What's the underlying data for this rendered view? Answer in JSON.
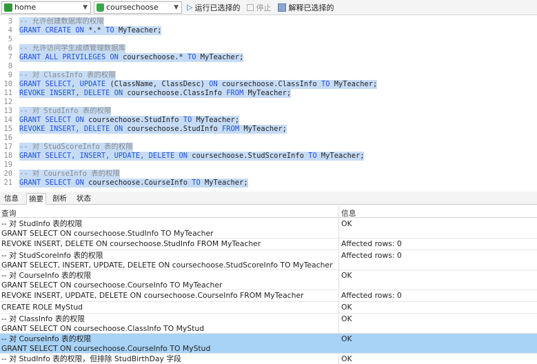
{
  "toolbar": {
    "connection": "home",
    "database": "coursechoose",
    "run_selected": "运行已选择的",
    "stop": "停止",
    "explain_selected": "解释已选择的"
  },
  "editor": {
    "lines": [
      {
        "n": "3",
        "segments": [
          {
            "t": "-- 允许创建数据库的权限",
            "c": "cm"
          }
        ]
      },
      {
        "n": "4",
        "segments": [
          {
            "t": "GRANT CREATE ON ",
            "c": "kw"
          },
          {
            "t": "*.* ",
            "c": "tx"
          },
          {
            "t": "TO ",
            "c": "kw"
          },
          {
            "t": "MyTeacher;",
            "c": "tx"
          }
        ]
      },
      {
        "n": "5",
        "segments": []
      },
      {
        "n": "6",
        "segments": [
          {
            "t": "-- 允许访问学生成绩管理数据库",
            "c": "cm"
          }
        ]
      },
      {
        "n": "7",
        "segments": [
          {
            "t": "GRANT ALL PRIVILEGES ON ",
            "c": "kw"
          },
          {
            "t": "coursechoose.* ",
            "c": "tx"
          },
          {
            "t": "TO ",
            "c": "kw"
          },
          {
            "t": "MyTeacher;",
            "c": "tx"
          }
        ]
      },
      {
        "n": "8",
        "segments": []
      },
      {
        "n": "9",
        "segments": [
          {
            "t": "-- 对 ClassInfo 表的权限",
            "c": "cm"
          }
        ]
      },
      {
        "n": "10",
        "segments": [
          {
            "t": "GRANT SELECT, UPDATE ",
            "c": "kw"
          },
          {
            "t": "(ClassName, ClassDesc) ",
            "c": "tx"
          },
          {
            "t": "ON ",
            "c": "kw"
          },
          {
            "t": "coursechoose.ClassInfo ",
            "c": "tx"
          },
          {
            "t": "TO ",
            "c": "kw"
          },
          {
            "t": "MyTeacher;",
            "c": "tx"
          }
        ]
      },
      {
        "n": "11",
        "segments": [
          {
            "t": "REVOKE INSERT, DELETE ON ",
            "c": "kw"
          },
          {
            "t": "coursechoose.ClassInfo ",
            "c": "tx"
          },
          {
            "t": "FROM ",
            "c": "kw"
          },
          {
            "t": "MyTeacher;",
            "c": "tx"
          }
        ]
      },
      {
        "n": "12",
        "segments": []
      },
      {
        "n": "13",
        "segments": [
          {
            "t": "-- 对 StudInfo 表的权限",
            "c": "cm"
          }
        ]
      },
      {
        "n": "14",
        "segments": [
          {
            "t": "GRANT SELECT ON ",
            "c": "kw"
          },
          {
            "t": "coursechoose.StudInfo ",
            "c": "tx"
          },
          {
            "t": "TO ",
            "c": "kw"
          },
          {
            "t": "MyTeacher;",
            "c": "tx"
          }
        ]
      },
      {
        "n": "15",
        "segments": [
          {
            "t": "REVOKE INSERT, DELETE ON ",
            "c": "kw"
          },
          {
            "t": "coursechoose.StudInfo ",
            "c": "tx"
          },
          {
            "t": "FROM ",
            "c": "kw"
          },
          {
            "t": "MyTeacher;",
            "c": "tx"
          }
        ]
      },
      {
        "n": "16",
        "segments": []
      },
      {
        "n": "17",
        "segments": [
          {
            "t": "-- 对 StudScoreInfo 表的权限",
            "c": "cm"
          }
        ]
      },
      {
        "n": "18",
        "segments": [
          {
            "t": "GRANT SELECT, INSERT, UPDATE, DELETE ON ",
            "c": "kw"
          },
          {
            "t": "coursechoose.StudScoreInfo ",
            "c": "tx"
          },
          {
            "t": "TO ",
            "c": "kw"
          },
          {
            "t": "MyTeacher;",
            "c": "tx"
          }
        ]
      },
      {
        "n": "19",
        "segments": []
      },
      {
        "n": "20",
        "segments": [
          {
            "t": "-- 对 CourseInfo 表的权限",
            "c": "cm"
          }
        ]
      },
      {
        "n": "21",
        "segments": [
          {
            "t": "GRANT SELECT ON ",
            "c": "kw"
          },
          {
            "t": "coursechoose.CourseInfo ",
            "c": "tx"
          },
          {
            "t": "TO ",
            "c": "kw"
          },
          {
            "t": "MyTeacher;",
            "c": "tx"
          }
        ]
      }
    ]
  },
  "tabs": [
    {
      "label": "信息",
      "active": false
    },
    {
      "label": "摘要",
      "active": true
    },
    {
      "label": "剖析",
      "active": false
    },
    {
      "label": "状态",
      "active": false
    }
  ],
  "results": {
    "headers": {
      "query": "查询",
      "info": "信息"
    },
    "rows": [
      {
        "q": "-- 对 StudInfo 表的权限\nGRANT SELECT ON coursechoose.StudInfo TO MyTeacher",
        "i": "OK",
        "lines": 2,
        "selected": false
      },
      {
        "q": "REVOKE INSERT, DELETE ON coursechoose.StudInfo FROM MyTeacher",
        "i": "Affected rows: 0",
        "lines": 1,
        "selected": false
      },
      {
        "q": "-- 对 StudScoreInfo 表的权限\nGRANT SELECT, INSERT, UPDATE, DELETE ON coursechoose.StudScoreInfo TO MyTeacher",
        "i": "Affected rows: 0",
        "lines": 2,
        "selected": false
      },
      {
        "q": "-- 对 CourseInfo 表的权限\nGRANT SELECT ON coursechoose.CourseInfo TO MyTeacher",
        "i": "OK",
        "lines": 2,
        "selected": false
      },
      {
        "q": "REVOKE INSERT, UPDATE, DELETE ON coursechoose.CourseInfo FROM MyTeacher",
        "i": "Affected rows: 0",
        "lines": 1,
        "selected": false
      },
      {
        "q": "CREATE ROLE MyStud",
        "i": "OK",
        "lines": 1,
        "selected": false
      },
      {
        "q": "-- 对 ClassInfo 表的权限\nGRANT SELECT ON coursechoose.ClassInfo TO MyStud",
        "i": "OK",
        "lines": 2,
        "selected": false
      },
      {
        "q": "-- 对 CourseInfo 表的权限\nGRANT SELECT ON coursechoose.CourseInfo TO MyStud",
        "i": "OK",
        "lines": 2,
        "selected": true
      },
      {
        "q": "-- 对 StudInfo 表的权限，但排除 StudBirthDay 字段",
        "i": "OK",
        "lines": 1,
        "selected": false
      }
    ]
  }
}
